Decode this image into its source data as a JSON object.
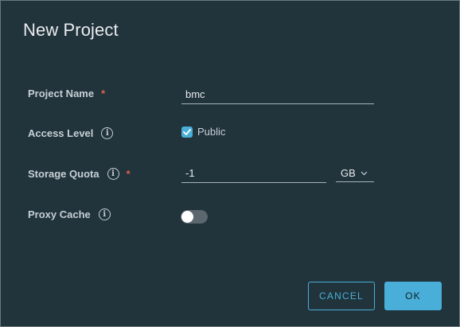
{
  "dialog": {
    "title": "New Project"
  },
  "fields": {
    "project_name": {
      "label": "Project Name",
      "required_mark": "*",
      "value": "bmc"
    },
    "access_level": {
      "label": "Access Level",
      "info_glyph": "i",
      "checkbox_label": "Public",
      "checked": true
    },
    "storage_quota": {
      "label": "Storage Quota",
      "info_glyph": "i",
      "required_mark": "*",
      "value": "-1",
      "unit": "GB"
    },
    "proxy_cache": {
      "label": "Proxy Cache",
      "info_glyph": "i",
      "enabled": false
    }
  },
  "buttons": {
    "cancel": "CANCEL",
    "ok": "OK"
  },
  "colors": {
    "background": "#21333b",
    "accent": "#49afd9",
    "required": "#e25d4d"
  },
  "icons": [
    "info-icon",
    "check-icon",
    "chevron-down-icon"
  ]
}
